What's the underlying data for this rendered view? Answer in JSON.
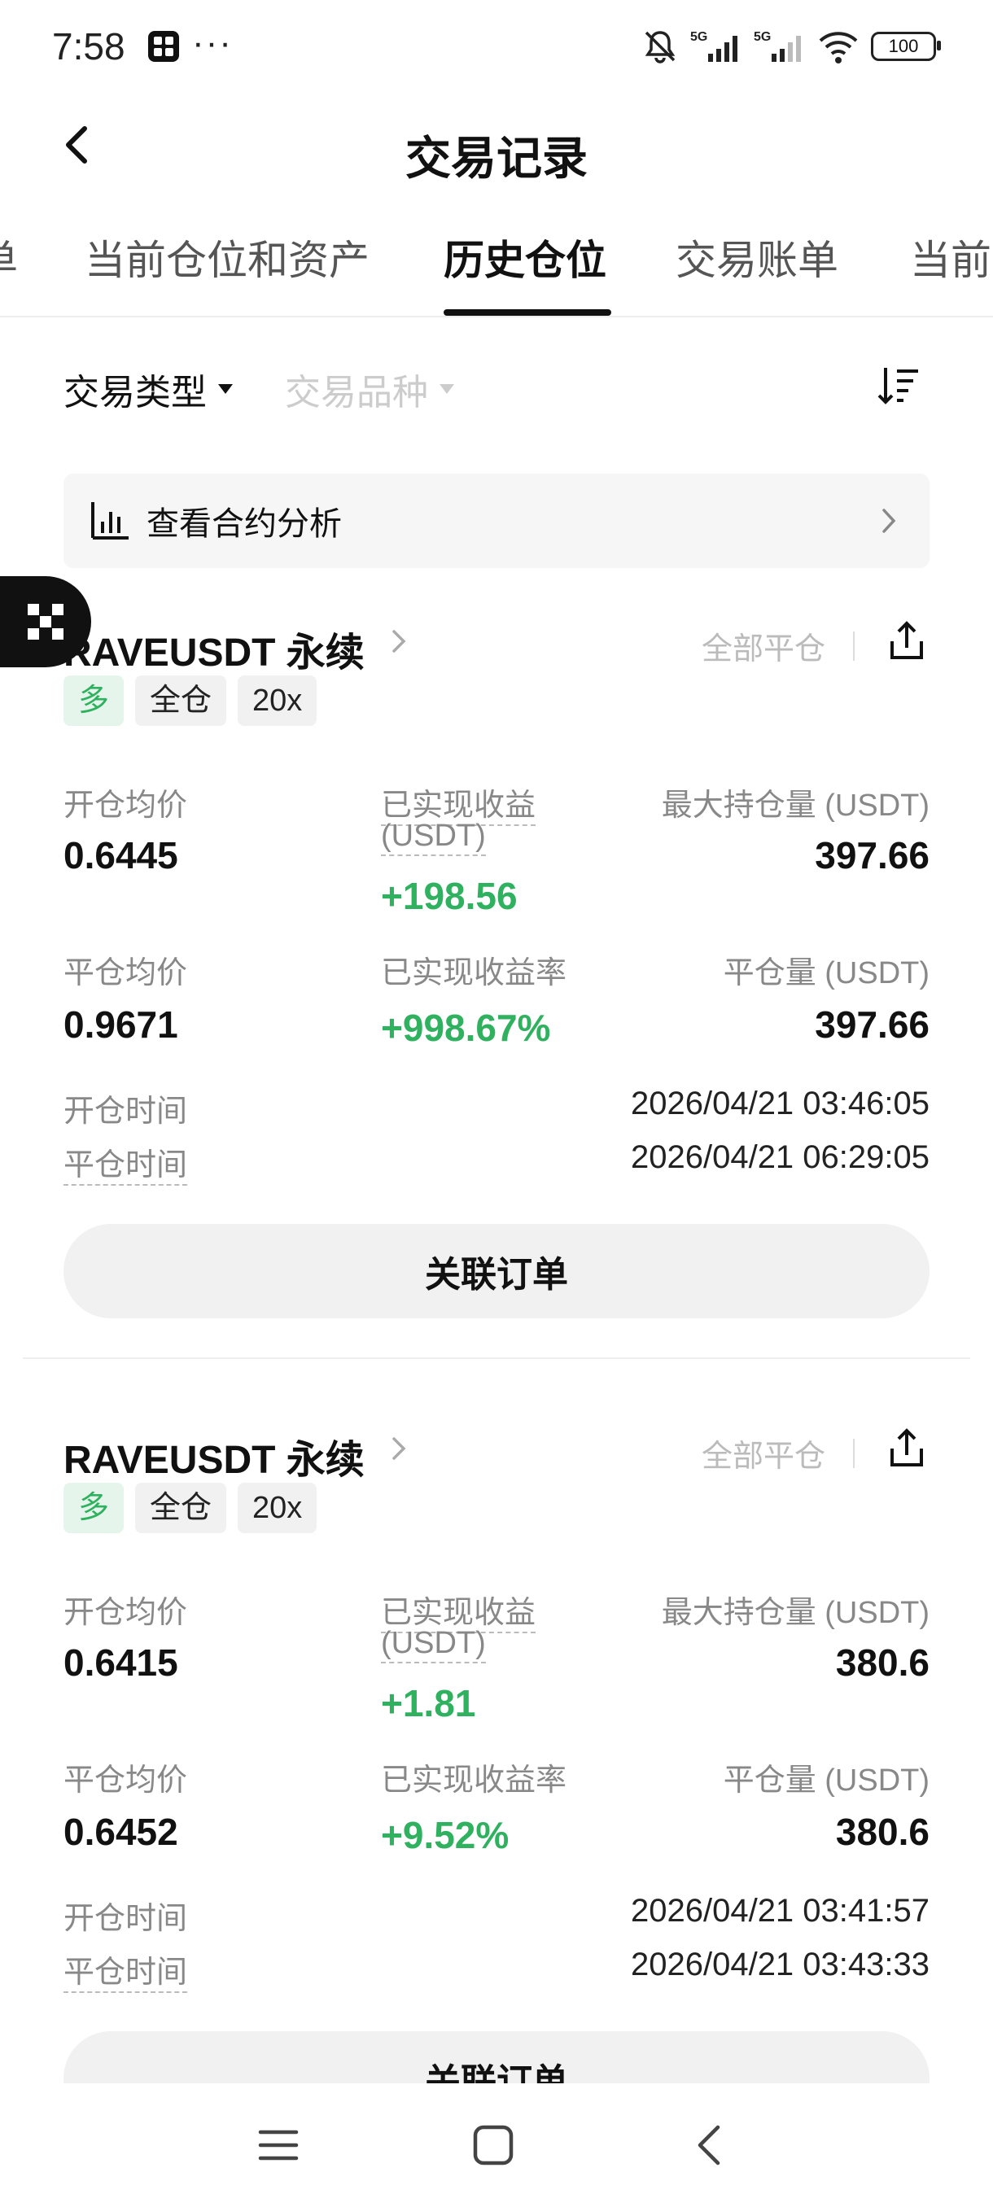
{
  "status_bar": {
    "time": "7:58",
    "dots": "···",
    "battery": "100"
  },
  "header": {
    "title": "交易记录"
  },
  "tabs": [
    {
      "label": "单"
    },
    {
      "label": "当前仓位和资产"
    },
    {
      "label": "历史仓位"
    },
    {
      "label": "交易账单"
    },
    {
      "label": "当前"
    }
  ],
  "filters": {
    "trade_type": "交易类型",
    "instrument": "交易品种"
  },
  "analysis": {
    "label": "查看合约分析"
  },
  "labels": {
    "open_avg": "开仓均价",
    "realized_pnl": "已实现收益",
    "realized_pnl_unit": "(USDT)",
    "max_position": "最大持仓量 (USDT)",
    "close_avg": "平仓均价",
    "realized_pnl_rate": "已实现收益率",
    "close_amount": "平仓量 (USDT)",
    "open_time": "开仓时间",
    "close_time": "平仓时间",
    "close_all": "全部平仓",
    "related_orders": "关联订单"
  },
  "positions": [
    {
      "symbol": "RAVEUSDT 永续",
      "side": "多",
      "margin_mode": "全仓",
      "leverage": "20x",
      "open_avg": "0.6445",
      "realized_pnl": "+198.56",
      "max_position": "397.66",
      "close_avg": "0.9671",
      "realized_pnl_rate": "+998.67%",
      "close_amount": "397.66",
      "open_time": "2026/04/21 03:46:05",
      "close_time": "2026/04/21 06:29:05"
    },
    {
      "symbol": "RAVEUSDT 永续",
      "side": "多",
      "margin_mode": "全仓",
      "leverage": "20x",
      "open_avg": "0.6415",
      "realized_pnl": "+1.81",
      "max_position": "380.6",
      "close_avg": "0.6452",
      "realized_pnl_rate": "+9.52%",
      "close_amount": "380.6",
      "open_time": "2026/04/21 03:41:57",
      "close_time": "2026/04/21 03:43:33"
    }
  ],
  "colors": {
    "profit": "#2fb15f",
    "muted": "#888888",
    "background": "#ffffff"
  },
  "icons": [
    "app-icon",
    "mute-icon",
    "signal-icon",
    "wifi-icon",
    "battery-icon",
    "back-icon",
    "sort-icon",
    "bar-chart-icon",
    "chevron-right-icon",
    "share-icon",
    "menu-icon",
    "home-icon"
  ]
}
